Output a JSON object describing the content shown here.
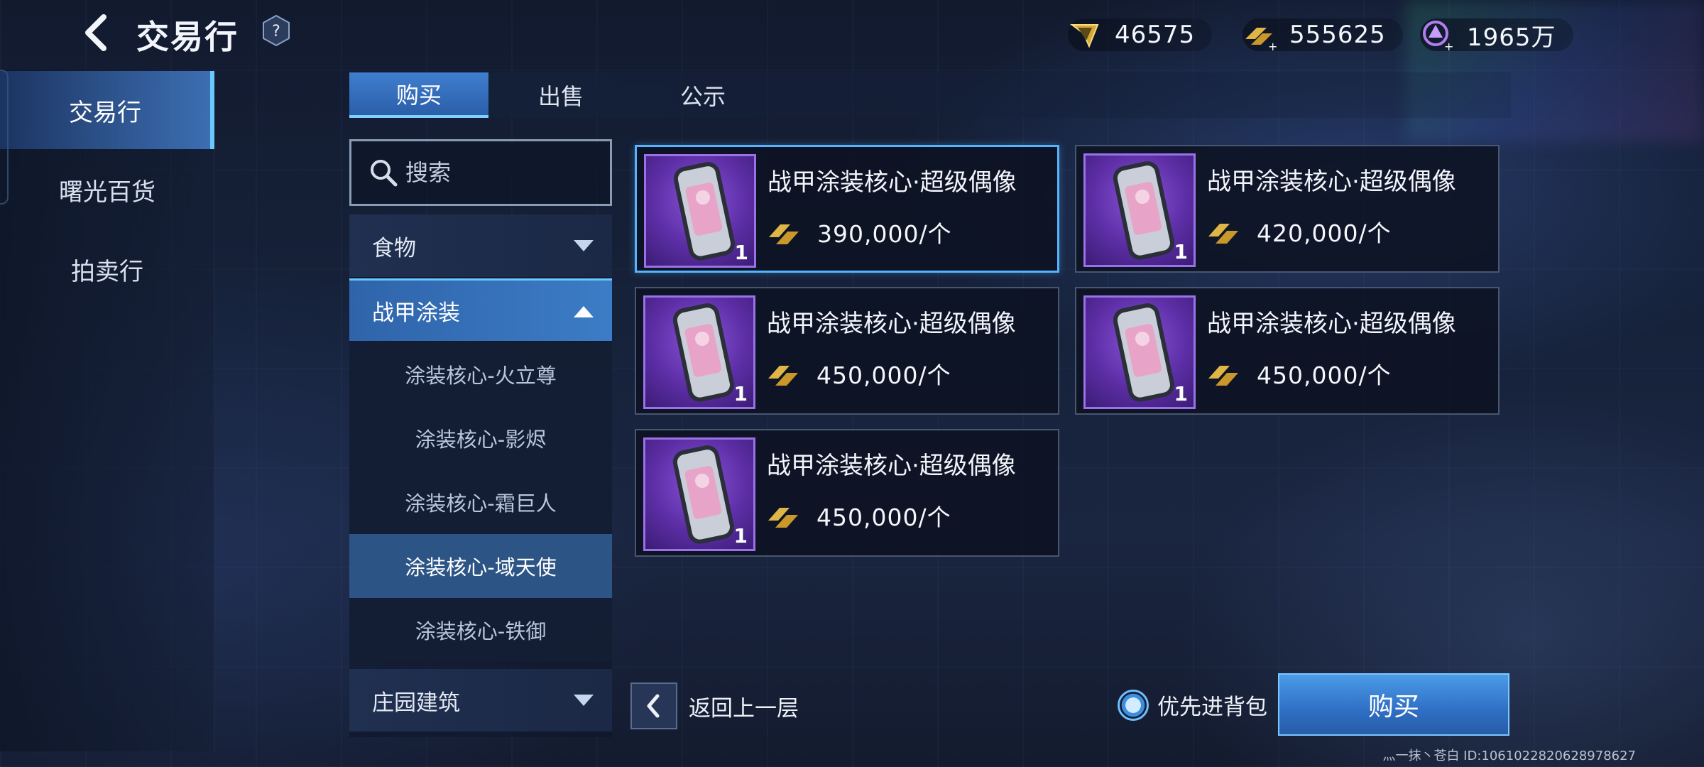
{
  "header": {
    "title": "交易行",
    "help_label": "?",
    "currencies": [
      {
        "icon": "energy-wings-icon",
        "value": "46575"
      },
      {
        "icon": "gold-bars-add-icon",
        "value": "555625"
      },
      {
        "icon": "purple-crystal-add-icon",
        "value": "1965万"
      }
    ]
  },
  "left_nav": {
    "items": [
      {
        "label": "交易行",
        "active": true
      },
      {
        "label": "曙光百货",
        "active": false
      },
      {
        "label": "拍卖行",
        "active": false
      }
    ]
  },
  "tabs": [
    {
      "label": "购买",
      "active": true
    },
    {
      "label": "出售",
      "active": false
    },
    {
      "label": "公示",
      "active": false
    }
  ],
  "search": {
    "placeholder": "搜索",
    "value": ""
  },
  "categories": [
    {
      "label": "食物",
      "state": "collapsed"
    },
    {
      "label": "战甲涂装",
      "state": "expanded",
      "subcategories": [
        {
          "label": "涂装核心-火立尊",
          "selected": false
        },
        {
          "label": "涂装核心-影烬",
          "selected": false
        },
        {
          "label": "涂装核心-霜巨人",
          "selected": false
        },
        {
          "label": "涂装核心-域天使",
          "selected": true
        },
        {
          "label": "涂装核心-铁御",
          "selected": false
        }
      ]
    },
    {
      "label": "庄园建筑",
      "state": "collapsed"
    }
  ],
  "listings": [
    {
      "name": "战甲涂装核心·超级偶像",
      "quantity": "1",
      "price": "390,000/个",
      "selected": true
    },
    {
      "name": "战甲涂装核心·超级偶像",
      "quantity": "1",
      "price": "420,000/个",
      "selected": false
    },
    {
      "name": "战甲涂装核心·超级偶像",
      "quantity": "1",
      "price": "450,000/个",
      "selected": false
    },
    {
      "name": "战甲涂装核心·超级偶像",
      "quantity": "1",
      "price": "450,000/个",
      "selected": false
    },
    {
      "name": "战甲涂装核心·超级偶像",
      "quantity": "1",
      "price": "450,000/个",
      "selected": false
    }
  ],
  "bottom": {
    "back_label": "返回上一层",
    "priority_label": "优先进背包",
    "buy_label": "购买"
  },
  "footer": {
    "player_id": "灬一抹丶苍白 ID:1061022820628978627"
  }
}
